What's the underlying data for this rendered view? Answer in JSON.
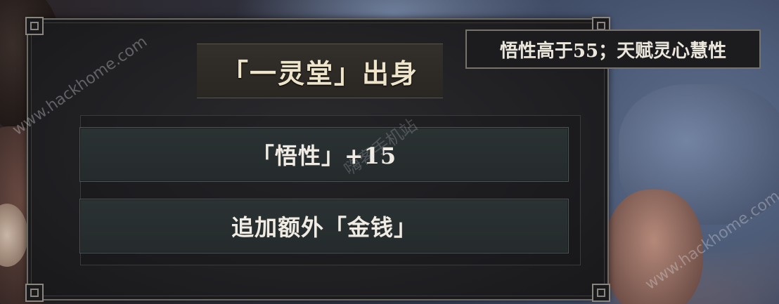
{
  "event": {
    "title": "「一灵堂」出身",
    "options": [
      {
        "label": "「悟性」+15"
      },
      {
        "label": "追加额外「金钱」"
      }
    ]
  },
  "tooltip": {
    "text": "悟性高于55；天赋灵心慧性"
  },
  "watermarks": {
    "left": "www.hackhome.com",
    "right": "www.hackhome.com",
    "center": "嗨客手机站"
  }
}
